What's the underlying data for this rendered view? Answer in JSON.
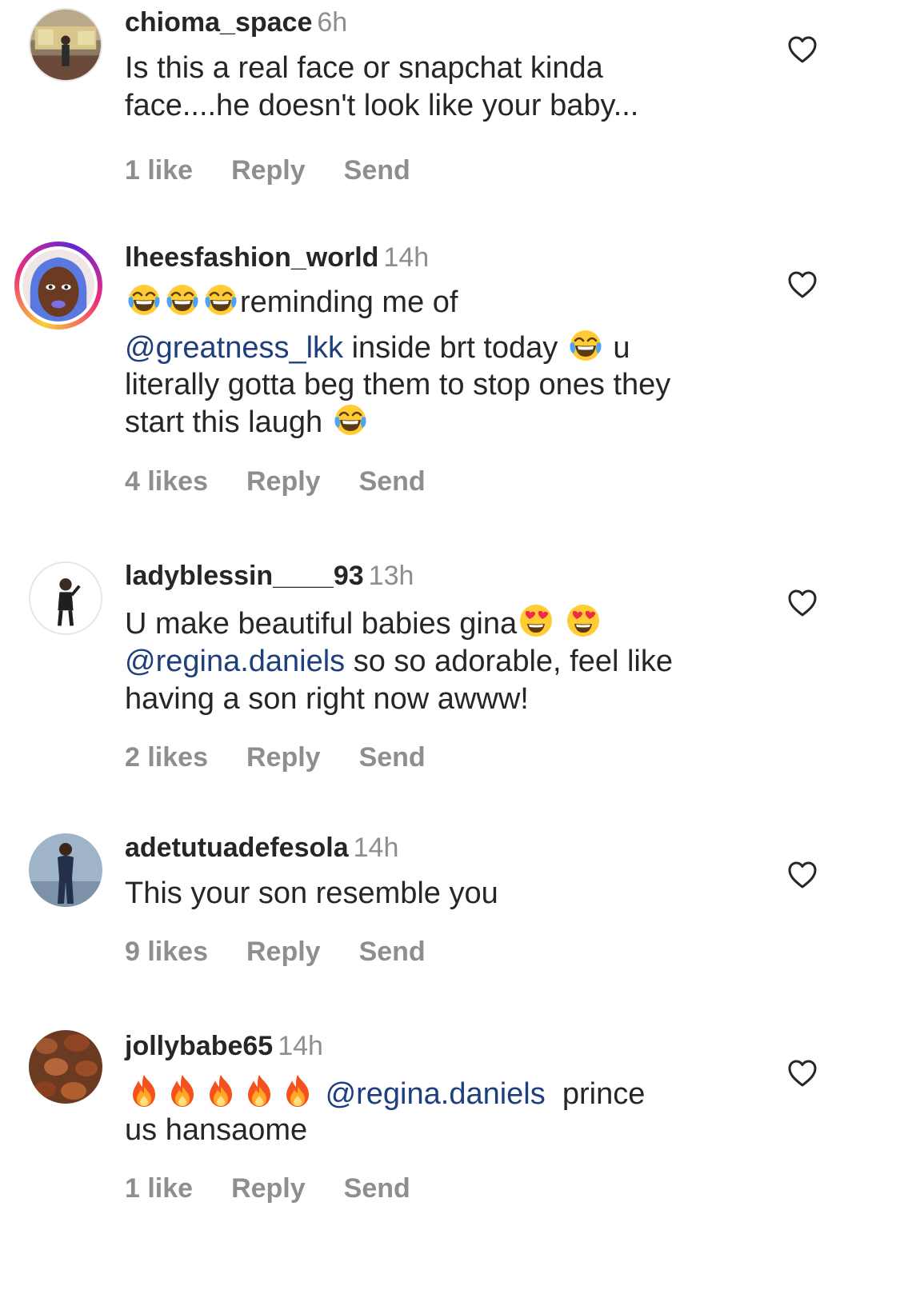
{
  "comments": [
    {
      "username": "chioma_space",
      "time": "6h",
      "line1": "Is this a real face or snapchat kinda",
      "line2": "face....he doesn't look like your baby...",
      "likes": "1 like",
      "reply": "Reply",
      "send": "Send",
      "heart_icon": "heart-outline-icon"
    },
    {
      "username": "lheesfashion_world",
      "time": "14h",
      "line1_text": "reminding me of",
      "mention": "@greatness_lkk",
      "line2_text": " inside brt today ",
      "line2_tail": " u",
      "line3": "literally gotta beg them to stop ones they",
      "line4": "start this laugh ",
      "likes": "4 likes",
      "reply": "Reply",
      "send": "Send",
      "emoji": "tears-of-joy-emoji"
    },
    {
      "username": "ladyblessin____93",
      "time": "13h",
      "line1_text": "U make beautiful babies gina",
      "mention": "@regina.daniels",
      "line2_text": " so so adorable, feel like",
      "line3": "having a son right now awww!",
      "likes": "2 likes",
      "reply": "Reply",
      "send": "Send",
      "emoji": "heart-eyes-emoji"
    },
    {
      "username": "adetutuadefesola",
      "time": "14h",
      "line1": "This your son resemble you",
      "likes": "9 likes",
      "reply": "Reply",
      "send": "Send"
    },
    {
      "username": "jollybabe65",
      "time": "14h",
      "mention": "@regina.daniels",
      "line1_tail": "  prince",
      "line2": "us hansaome",
      "likes": "1 like",
      "reply": "Reply",
      "send": "Send",
      "emoji": "fire-emoji"
    }
  ],
  "colors": {
    "text": "#262626",
    "muted": "#8e8e8e",
    "mention": "#1e3f7d"
  }
}
